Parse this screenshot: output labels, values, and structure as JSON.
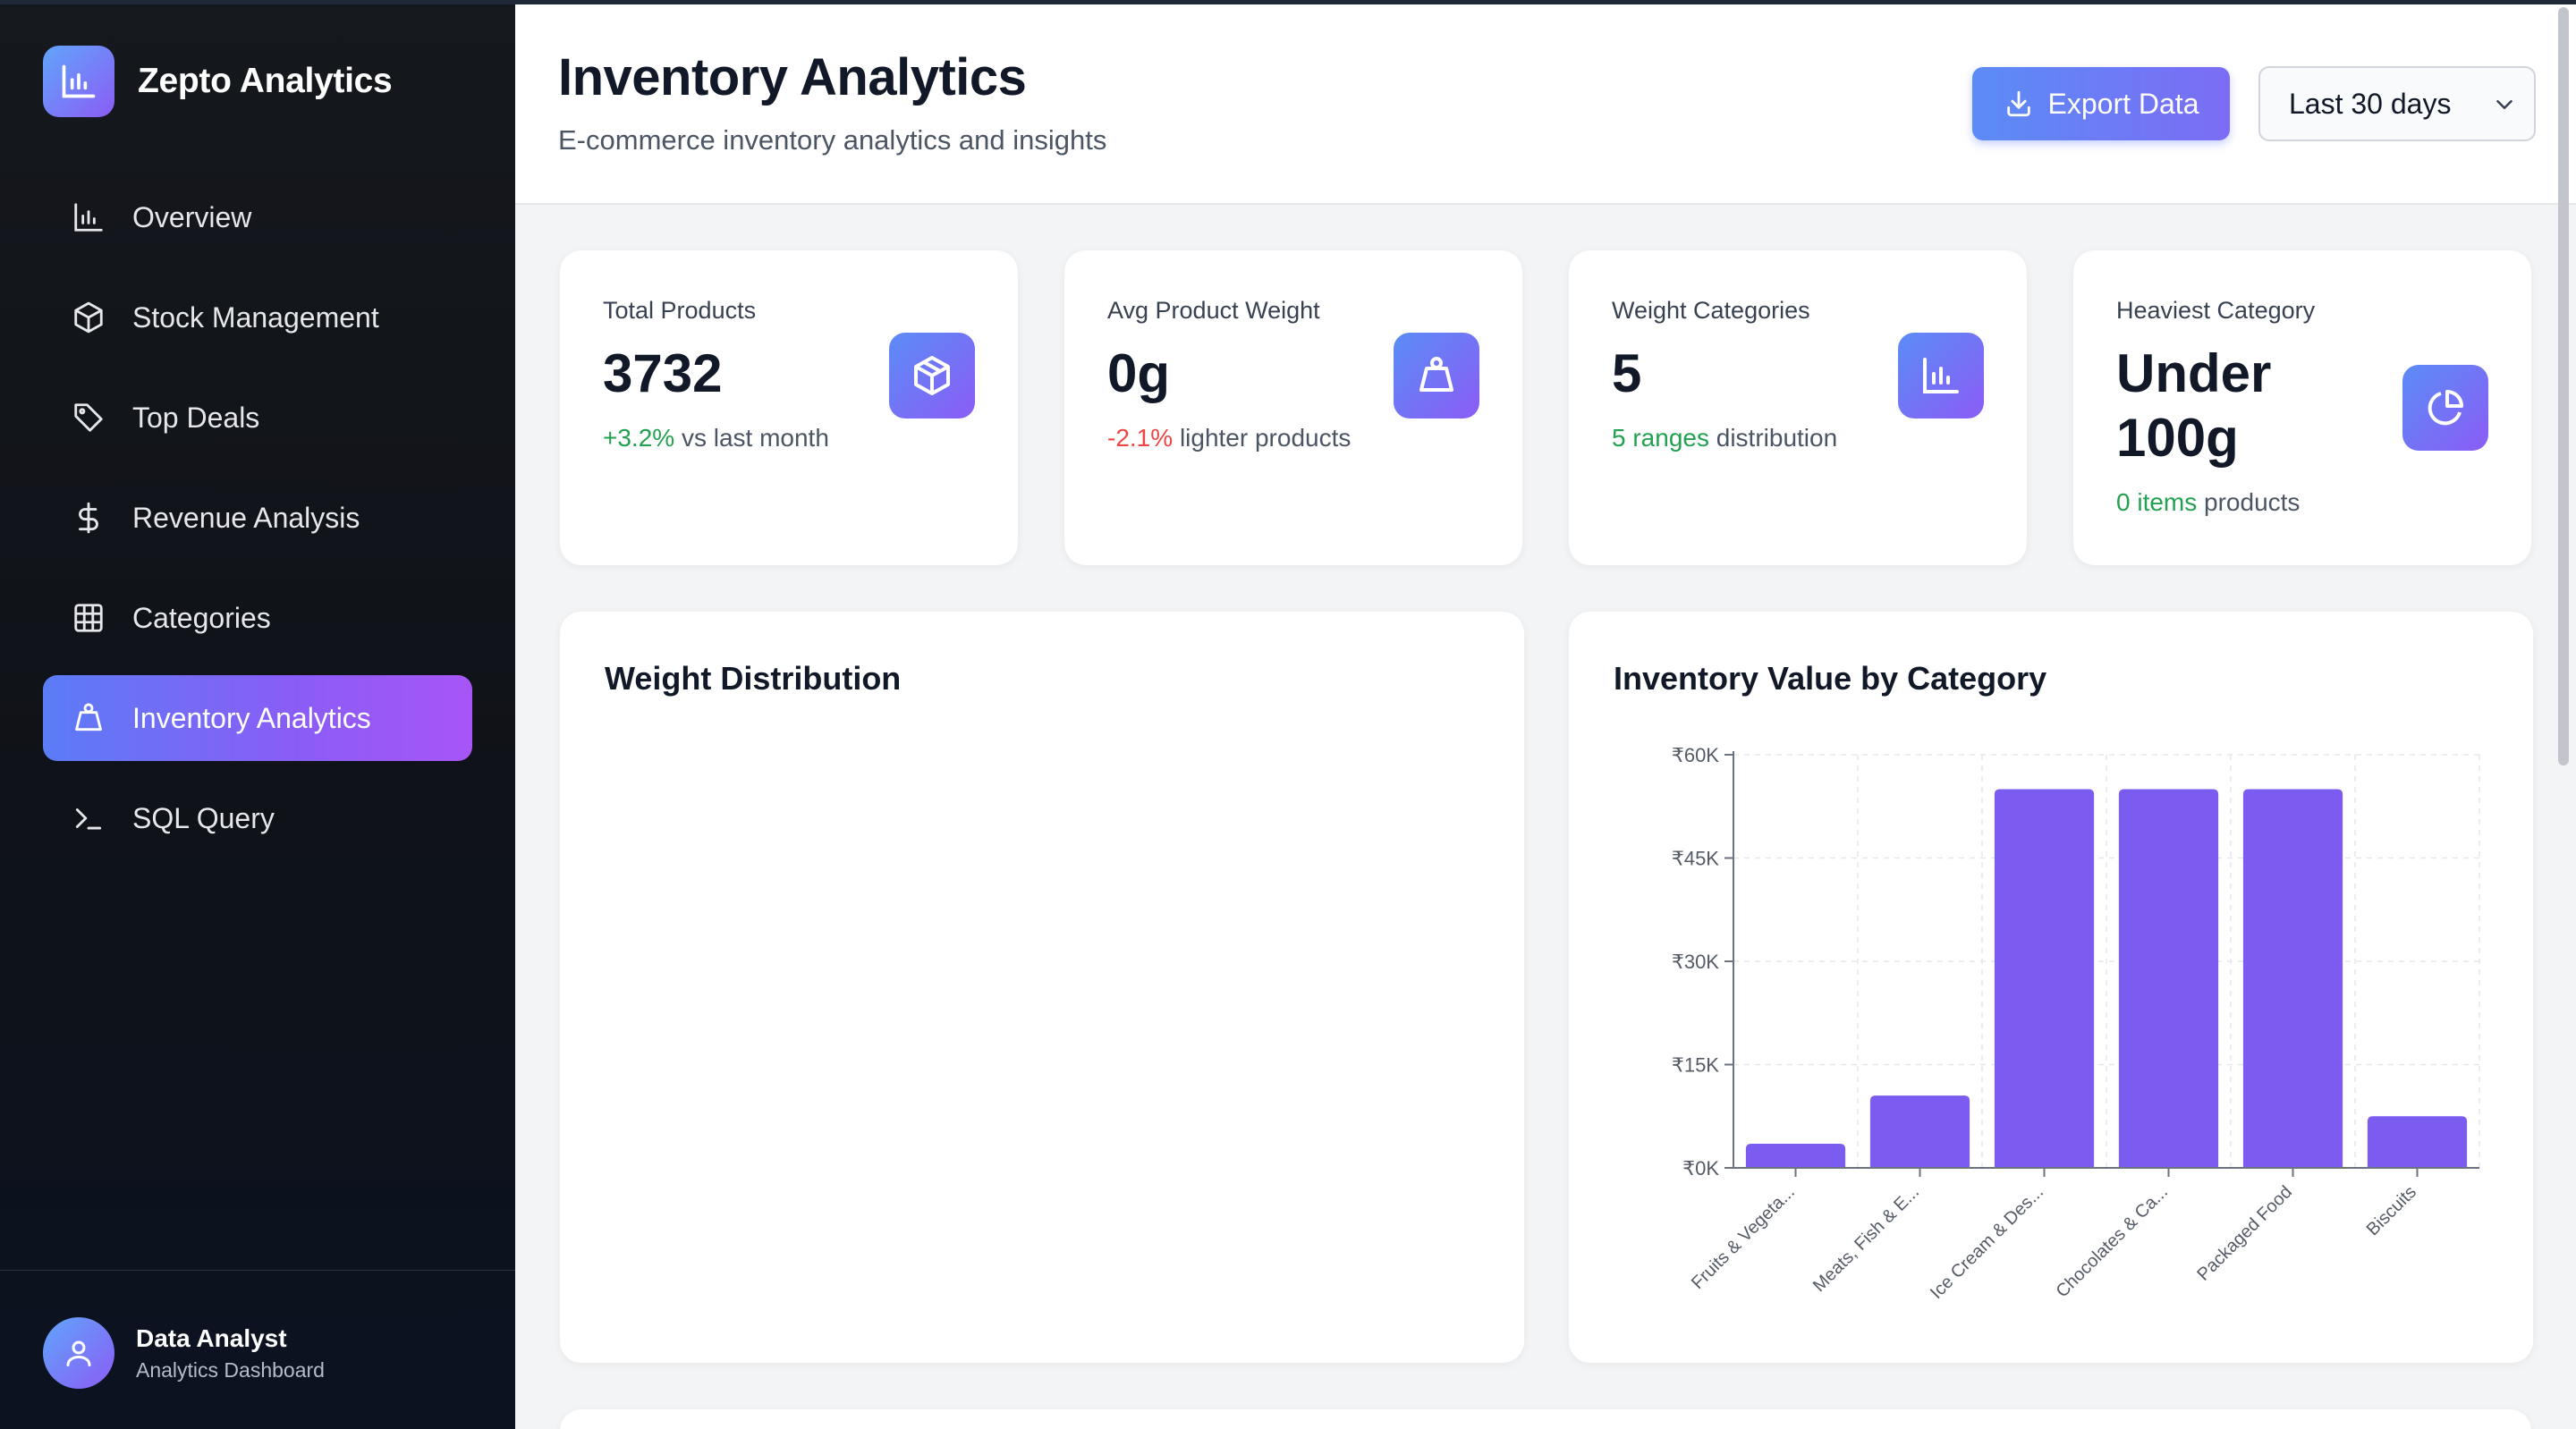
{
  "app": {
    "name": "Zepto Analytics"
  },
  "sidebar": {
    "items": [
      {
        "label": "Overview",
        "icon": "bar-chart-icon",
        "active": false
      },
      {
        "label": "Stock Management",
        "icon": "box-icon",
        "active": false
      },
      {
        "label": "Top Deals",
        "icon": "tag-icon",
        "active": false
      },
      {
        "label": "Revenue Analysis",
        "icon": "dollar-icon",
        "active": false
      },
      {
        "label": "Categories",
        "icon": "grid-icon",
        "active": false
      },
      {
        "label": "Inventory Analytics",
        "icon": "weight-icon",
        "active": true
      },
      {
        "label": "SQL Query",
        "icon": "terminal-icon",
        "active": false
      }
    ],
    "user": {
      "name": "Data Analyst",
      "role": "Analytics Dashboard"
    }
  },
  "header": {
    "title": "Inventory Analytics",
    "subtitle": "E-commerce inventory analytics and insights",
    "export_label": "Export Data",
    "range_value": "Last 30 days"
  },
  "stats": [
    {
      "label": "Total Products",
      "value": "3732",
      "highlight": "+3.2%",
      "note": "vs last month",
      "trend": "up",
      "icon": "box-icon"
    },
    {
      "label": "Avg Product Weight",
      "value": "0g",
      "highlight": "-2.1%",
      "note": "lighter products",
      "trend": "down",
      "icon": "weight-icon"
    },
    {
      "label": "Weight Categories",
      "value": "5",
      "highlight": "5 ranges",
      "note": "distribution",
      "trend": "up",
      "icon": "bar-chart-icon"
    },
    {
      "label": "Heaviest Category",
      "value": "Under 100g",
      "highlight": "0 items",
      "note": "products",
      "trend": "up",
      "icon": "pie-chart-icon"
    }
  ],
  "panels": {
    "weight_distribution": {
      "title": "Weight Distribution"
    },
    "inventory_value": {
      "title": "Inventory Value by Category"
    }
  },
  "colors": {
    "accent": "#8b5cf6",
    "bar": "#7c5cf0",
    "positive": "#22a150",
    "negative": "#ef4444"
  },
  "chart_data": {
    "type": "bar",
    "title": "Inventory Value by Category",
    "categories": [
      "Fruits & Vegeta...",
      "Meats, Fish & E...",
      "Ice Cream & Des...",
      "Chocolates & Ca...",
      "Packaged Food",
      "Biscuits"
    ],
    "values": [
      3500,
      10500,
      55000,
      55000,
      55000,
      7500
    ],
    "ylim": [
      0,
      60000
    ],
    "yticks": [
      0,
      15000,
      30000,
      45000,
      60000
    ],
    "ytick_labels": [
      "₹0K",
      "₹15K",
      "₹30K",
      "₹45K",
      "₹60K"
    ],
    "grid": true
  }
}
